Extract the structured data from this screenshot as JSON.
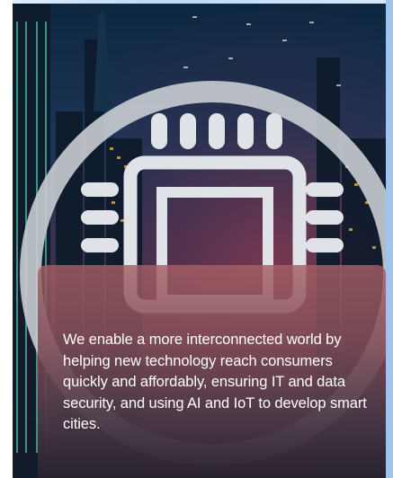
{
  "hero": {
    "background": "city-skyline-at-night",
    "icon": "microchip-icon",
    "colors": {
      "ring": "#c9cdd3",
      "chip": "#dfe2e6",
      "card_top": "#a55f64",
      "card_bottom": "#28222e",
      "right_border": "#9cc4ef"
    }
  },
  "card": {
    "text": "We enable a more interconnected world by helping new technology reach consumers quickly and affordably, ensuring IT and data security, and using AI and IoT to develop smart cities."
  }
}
